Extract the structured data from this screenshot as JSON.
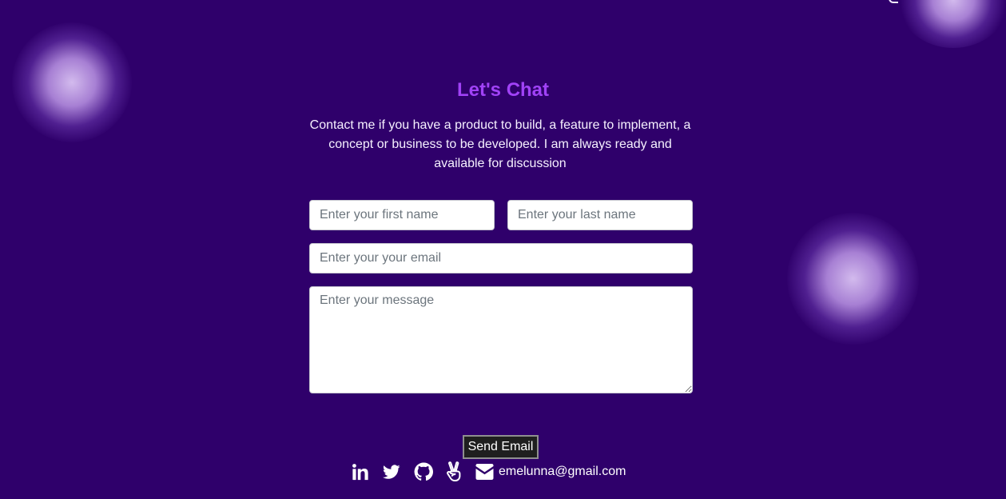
{
  "theme": {
    "background": "#2f006b",
    "title_color": "#a142f7",
    "text_color": "#ffffff",
    "button_color": "#1f1f1f"
  },
  "contact": {
    "title": "Let's Chat",
    "description": "Contact me if you have a product to build, a feature to implement, a concept or business to be developed. I am always ready and available for discussion",
    "fields": {
      "first_name_placeholder": "Enter your first name",
      "last_name_placeholder": "Enter your last name",
      "email_placeholder": "Enter your your email",
      "message_placeholder": "Enter your message"
    },
    "send_label": "Send Email"
  },
  "footer": {
    "links": [
      {
        "icon": "linkedin-icon"
      },
      {
        "icon": "twitter-icon"
      },
      {
        "icon": "github-icon"
      },
      {
        "icon": "angellist-icon"
      },
      {
        "icon": "envelope-icon",
        "label": "emelunna@gmail.com"
      }
    ]
  }
}
